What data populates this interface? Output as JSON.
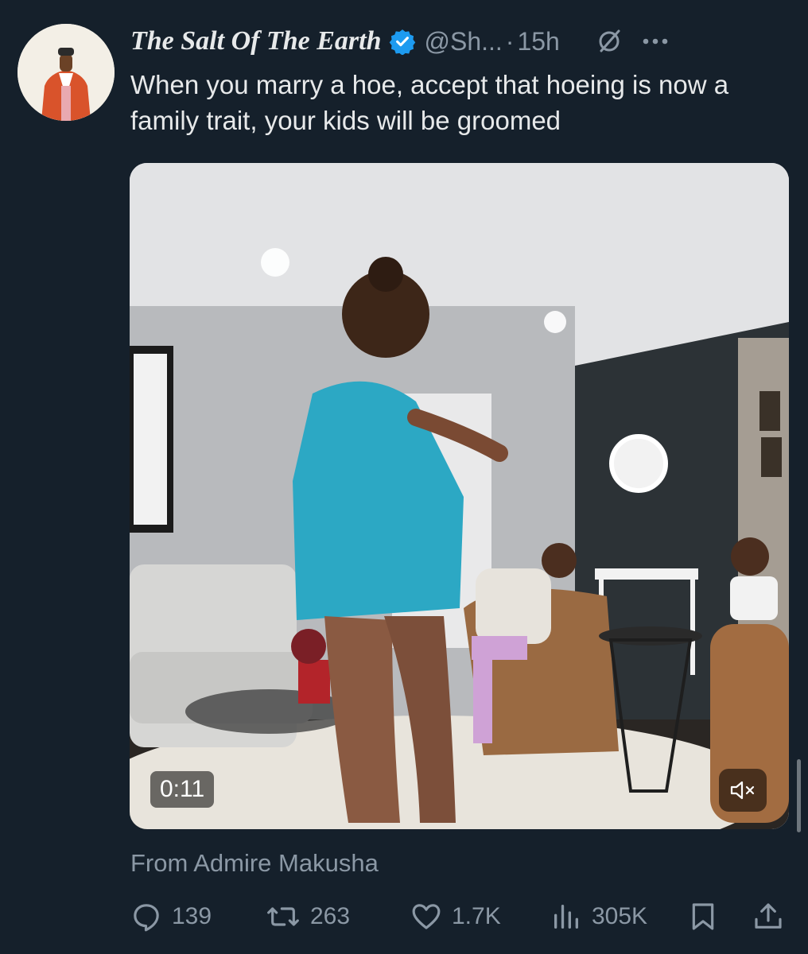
{
  "tweet": {
    "author_name": "The Salt Of The Earth",
    "handle": "@Sh...",
    "dot": "·",
    "time": "15h",
    "text": "When you marry a hoe, accept that hoeing is now a family trait, your kids will be groomed",
    "media": {
      "duration": "0:11",
      "muted": true
    },
    "source": "From Admire Makusha"
  },
  "actions": {
    "replies": "139",
    "reposts": "263",
    "likes": "1.7K",
    "views": "305K"
  },
  "icons": {
    "verified": "verified-badge-icon",
    "grok": "grok-icon",
    "more": "more-icon",
    "mute": "speaker-muted-icon",
    "reply": "reply-icon",
    "repost": "repost-icon",
    "like": "heart-icon",
    "views": "views-bar-chart-icon",
    "bookmark": "bookmark-icon",
    "share": "share-icon"
  },
  "colors": {
    "background": "#15202b",
    "text": "#e7e9ea",
    "secondary": "#8b98a5",
    "verified": "#1d9bf0"
  }
}
